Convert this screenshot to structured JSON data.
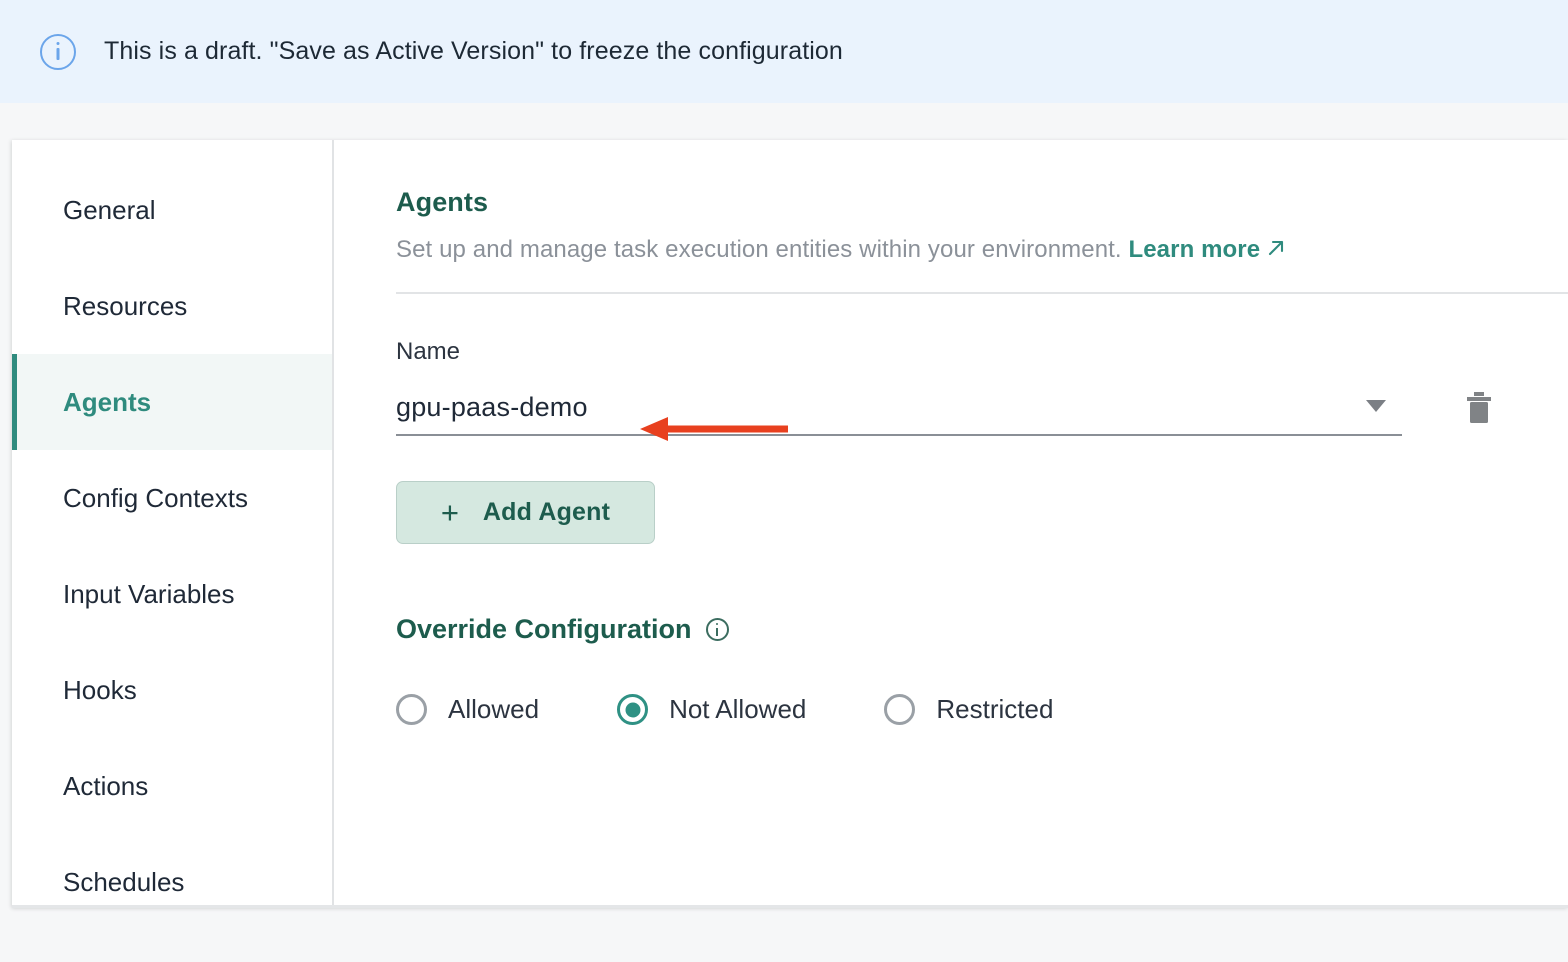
{
  "banner": {
    "icon": "info-circle-icon",
    "text": "This is a draft. \"Save as Active Version\" to freeze the configuration",
    "background_color": "#eaf3fd",
    "icon_color": "#6ba5ea"
  },
  "sidebar": {
    "items": [
      {
        "label": "General",
        "active": false
      },
      {
        "label": "Resources",
        "active": false
      },
      {
        "label": "Agents",
        "active": true
      },
      {
        "label": "Config Contexts",
        "active": false
      },
      {
        "label": "Input Variables",
        "active": false
      },
      {
        "label": "Hooks",
        "active": false
      },
      {
        "label": "Actions",
        "active": false
      },
      {
        "label": "Schedules",
        "active": false
      }
    ],
    "active_color": "#2f8b7e"
  },
  "main": {
    "title": "Agents",
    "description": "Set up and manage task execution entities within your environment.",
    "learn_more_label": "Learn more",
    "learn_more_icon": "external-link-icon",
    "name_field": {
      "label": "Name",
      "value": "gpu-paas-demo",
      "caret_icon": "chevron-down-icon",
      "delete_icon": "trash-icon"
    },
    "add_agent": {
      "plus_icon": "plus-icon",
      "label": "Add Agent"
    },
    "override": {
      "title": "Override Configuration",
      "info_icon": "info-circle-icon",
      "options": [
        {
          "label": "Allowed",
          "selected": false
        },
        {
          "label": "Not Allowed",
          "selected": true
        },
        {
          "label": "Restricted",
          "selected": false
        }
      ]
    }
  },
  "annotation": {
    "arrow_icon": "left-arrow-annotation",
    "color": "#e8401f"
  }
}
